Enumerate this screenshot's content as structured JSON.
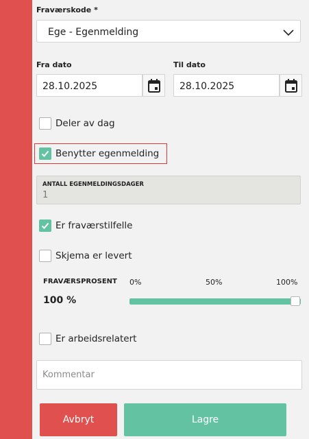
{
  "form": {
    "absence_code": {
      "label": "Fraværskode *",
      "value": "Ege - Egenmelding"
    },
    "from_date": {
      "label": "Fra dato",
      "value": "28.10.2025"
    },
    "to_date": {
      "label": "Til dato",
      "value": "28.10.2025"
    },
    "checkboxes": {
      "partial_day": {
        "label": "Deler av dag",
        "checked": false
      },
      "self_certification": {
        "label": "Benytter egenmelding",
        "checked": true
      },
      "absence_case": {
        "label": "Er fraværstilfelle",
        "checked": true
      },
      "form_delivered": {
        "label": "Skjema er levert",
        "checked": false
      },
      "work_related": {
        "label": "Er arbeidsrelatert",
        "checked": false
      }
    },
    "self_cert_days": {
      "label": "ANTALL EGENMELDINGSDAGER",
      "value": "1"
    },
    "absence_percent": {
      "label": "FRAVÆRSPROSENT",
      "value_text": "100 %",
      "value": 100,
      "ticks": [
        "0%",
        "50%",
        "100%"
      ]
    },
    "comment": {
      "placeholder": "Kommentar",
      "value": ""
    },
    "buttons": {
      "cancel": "Avbryt",
      "save": "Lagre"
    }
  },
  "colors": {
    "accent": "#62c2a2",
    "danger": "#e0504f",
    "highlight": "#d9373a"
  },
  "icons": {
    "dropdown": "chevron-down-icon",
    "calendar": "calendar-icon",
    "check": "check-icon"
  }
}
